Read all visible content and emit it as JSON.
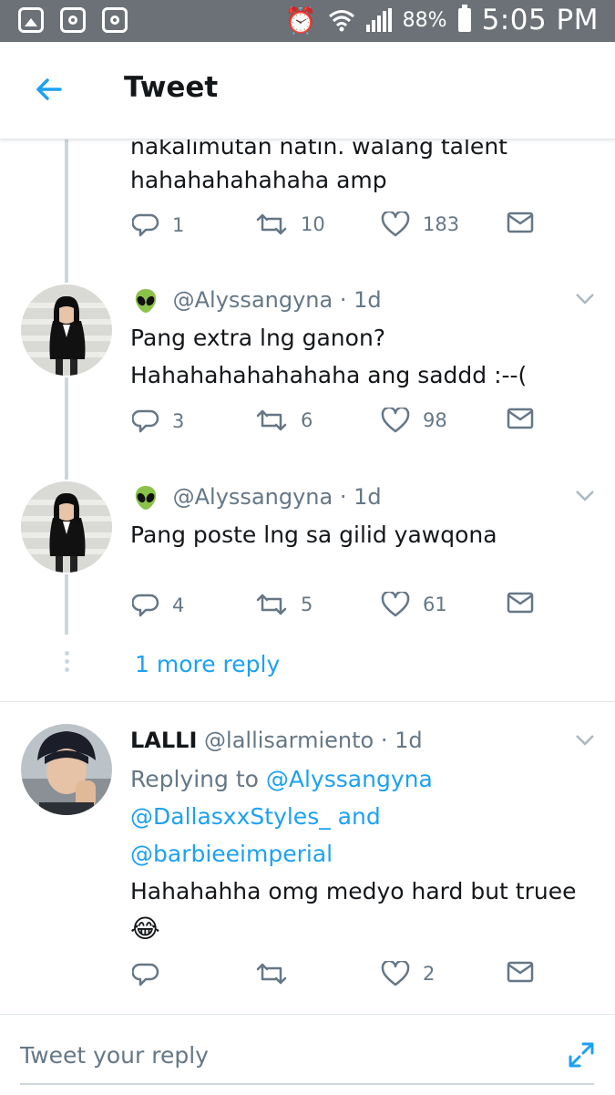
{
  "status_bar": {
    "battery": "88%",
    "time": "5:05 PM"
  },
  "header": {
    "title": "Tweet",
    "back_icon": "back-arrow-icon"
  },
  "colors": {
    "accent": "#1da1f2",
    "text": "#14171a",
    "muted": "#657786",
    "statusbar": "#6b7177"
  },
  "tweets": [
    {
      "text_lines": [
        "nakalimutan natin. walang talent",
        "hahahahahahaha amp"
      ],
      "replies": "1",
      "retweets": "10",
      "likes": "183"
    },
    {
      "handle": "@Alyssangyna",
      "time": "1d",
      "text_lines": [
        "Pang extra lng ganon?",
        "Hahahahahahahaha ang saddd :--("
      ],
      "replies": "3",
      "retweets": "6",
      "likes": "98"
    },
    {
      "handle": "@Alyssangyna",
      "time": "1d",
      "text_lines": [
        "Pang poste lng sa gilid yawqona"
      ],
      "replies": "4",
      "retweets": "5",
      "likes": "61"
    },
    {
      "display_name": "LALLI",
      "handle": "@lallisarmiento",
      "time": "1d",
      "replying_prefix": "Replying to",
      "replying_to": [
        "@Alyssangyna",
        "@DallasxxStyles_",
        "@barbieeimperial"
      ],
      "replying_and": "and",
      "text_lines": [
        "Hahahahha omg medyo hard but truee"
      ],
      "emoji": "😂",
      "replies": "",
      "retweets": "",
      "likes": "2"
    }
  ],
  "more_replies": "1 more reply",
  "separator": "·",
  "reply_placeholder": "Tweet your reply"
}
